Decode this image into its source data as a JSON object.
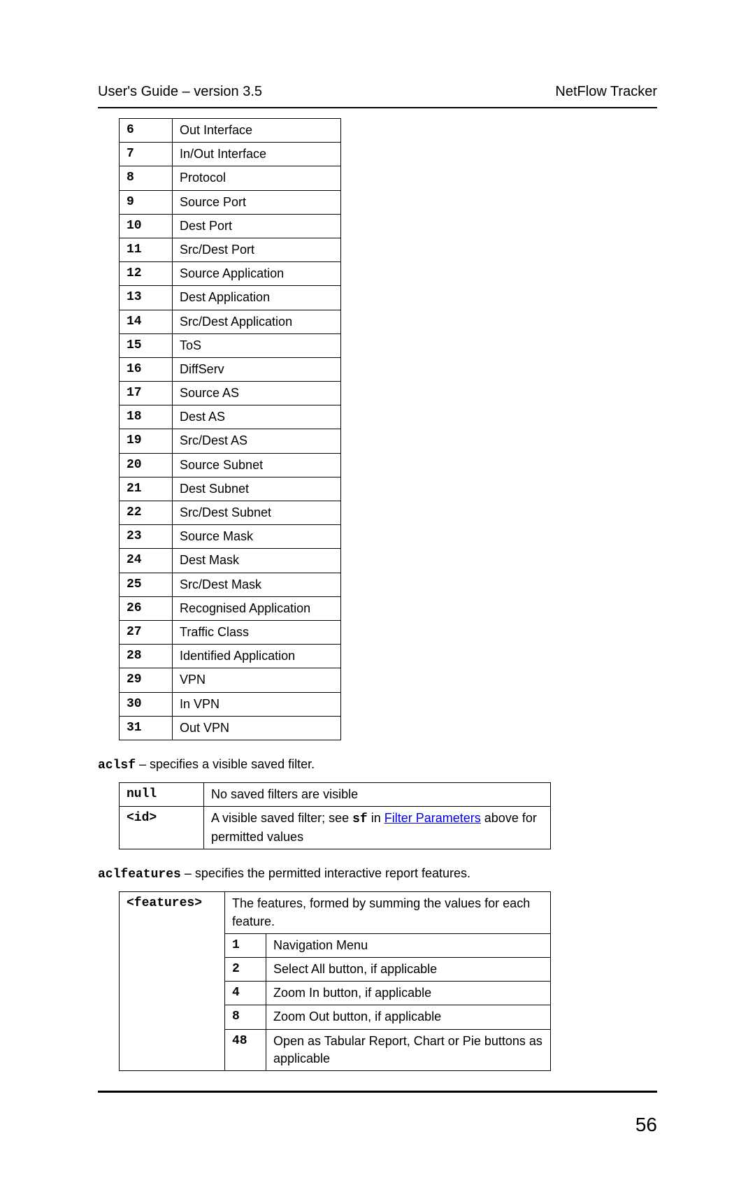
{
  "header": {
    "left": "User's Guide – version 3.5",
    "right": "NetFlow Tracker"
  },
  "table1": [
    {
      "n": "6",
      "label": "Out Interface"
    },
    {
      "n": "7",
      "label": "In/Out Interface"
    },
    {
      "n": "8",
      "label": "Protocol"
    },
    {
      "n": "9",
      "label": "Source Port"
    },
    {
      "n": "10",
      "label": "Dest Port"
    },
    {
      "n": "11",
      "label": "Src/Dest Port"
    },
    {
      "n": "12",
      "label": "Source Application"
    },
    {
      "n": "13",
      "label": "Dest Application"
    },
    {
      "n": "14",
      "label": "Src/Dest Application"
    },
    {
      "n": "15",
      "label": "ToS"
    },
    {
      "n": "16",
      "label": "DiffServ"
    },
    {
      "n": "17",
      "label": "Source AS"
    },
    {
      "n": "18",
      "label": "Dest AS"
    },
    {
      "n": "19",
      "label": "Src/Dest AS"
    },
    {
      "n": "20",
      "label": "Source Subnet"
    },
    {
      "n": "21",
      "label": "Dest Subnet"
    },
    {
      "n": "22",
      "label": "Src/Dest Subnet"
    },
    {
      "n": "23",
      "label": "Source Mask"
    },
    {
      "n": "24",
      "label": "Dest Mask"
    },
    {
      "n": "25",
      "label": "Src/Dest Mask"
    },
    {
      "n": "26",
      "label": "Recognised Application"
    },
    {
      "n": "27",
      "label": "Traffic Class"
    },
    {
      "n": "28",
      "label": "Identified Application"
    },
    {
      "n": "29",
      "label": "VPN"
    },
    {
      "n": "30",
      "label": "In VPN"
    },
    {
      "n": "31",
      "label": "Out VPN"
    }
  ],
  "para1": {
    "term": "aclsf",
    "desc": " – specifies a visible saved filter."
  },
  "table2": {
    "row1_key": "null",
    "row1_val": "No saved filters are visible",
    "row2_key": "<id>",
    "row2_pre": "A visible saved filter; see ",
    "row2_bold": "sf",
    "row2_mid": " in ",
    "row2_link": "Filter Parameters",
    "row2_post": " above for permitted values"
  },
  "para2": {
    "term": "aclfeatures",
    "desc": " – specifies the permitted interactive report features."
  },
  "table3": {
    "key": "<features>",
    "intro": "The features, formed by summing the values for each feature.",
    "items": [
      {
        "n": "1",
        "label": "Navigation Menu"
      },
      {
        "n": "2",
        "label": "Select All button, if applicable"
      },
      {
        "n": "4",
        "label": "Zoom In button, if applicable"
      },
      {
        "n": "8",
        "label": "Zoom Out button, if applicable"
      },
      {
        "n": "48",
        "label": "Open as Tabular Report, Chart or Pie buttons as applicable"
      }
    ]
  },
  "page_number": "56"
}
